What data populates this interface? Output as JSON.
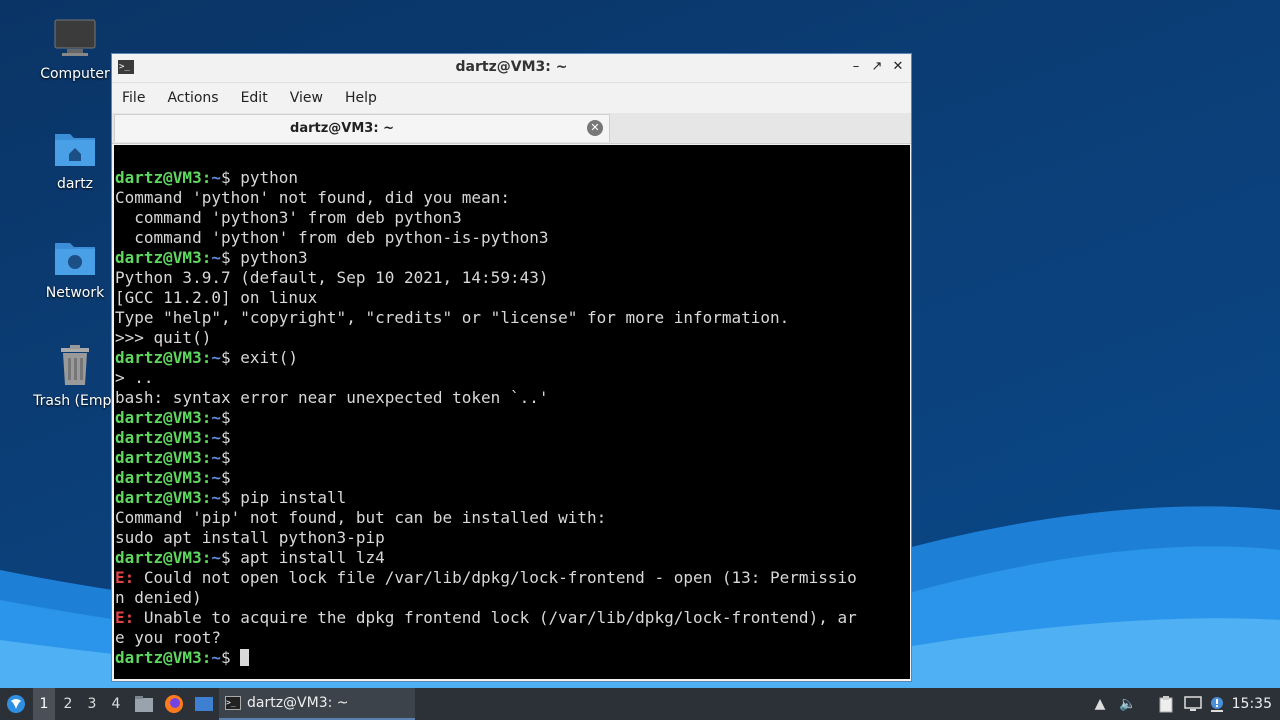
{
  "desktop": {
    "icons": [
      {
        "label": "Computer",
        "icon": "computer-icon"
      },
      {
        "label": "dartz",
        "icon": "home-folder-icon"
      },
      {
        "label": "Network",
        "icon": "network-folder-icon"
      },
      {
        "label": "Trash (Empt",
        "icon": "trash-icon"
      }
    ]
  },
  "window": {
    "title": "dartz@VM3: ~",
    "menu": [
      "File",
      "Actions",
      "Edit",
      "View",
      "Help"
    ],
    "tab_label": "dartz@VM3: ~"
  },
  "terminal": {
    "prompt_user": "dartz@VM3",
    "prompt_sep": ":",
    "prompt_path": "~",
    "prompt_dollar": "$ ",
    "error_tag": "E:",
    "lines": [
      {
        "type": "prompt",
        "cmd": "python"
      },
      {
        "type": "out",
        "text": "Command 'python' not found, did you mean:"
      },
      {
        "type": "out",
        "text": "  command 'python3' from deb python3"
      },
      {
        "type": "out",
        "text": "  command 'python' from deb python-is-python3"
      },
      {
        "type": "prompt",
        "cmd": "python3"
      },
      {
        "type": "out",
        "text": "Python 3.9.7 (default, Sep 10 2021, 14:59:43)"
      },
      {
        "type": "out",
        "text": "[GCC 11.2.0] on linux"
      },
      {
        "type": "out",
        "text": "Type \"help\", \"copyright\", \"credits\" or \"license\" for more information."
      },
      {
        "type": "out",
        "text": ">>> quit()"
      },
      {
        "type": "prompt",
        "cmd": "exit()"
      },
      {
        "type": "out",
        "text": "> .."
      },
      {
        "type": "out",
        "text": "bash: syntax error near unexpected token `..'"
      },
      {
        "type": "prompt",
        "cmd": ""
      },
      {
        "type": "prompt",
        "cmd": ""
      },
      {
        "type": "prompt",
        "cmd": ""
      },
      {
        "type": "prompt",
        "cmd": ""
      },
      {
        "type": "prompt",
        "cmd": "pip install"
      },
      {
        "type": "out",
        "text": "Command 'pip' not found, but can be installed with:"
      },
      {
        "type": "out",
        "text": "sudo apt install python3-pip"
      },
      {
        "type": "prompt",
        "cmd": "apt install lz4"
      },
      {
        "type": "err",
        "text": " Could not open lock file /var/lib/dpkg/lock-frontend - open (13: Permissio"
      },
      {
        "type": "out",
        "text": "n denied)"
      },
      {
        "type": "err",
        "text": " Unable to acquire the dpkg frontend lock (/var/lib/dpkg/lock-frontend), ar"
      },
      {
        "type": "out",
        "text": "e you root?"
      },
      {
        "type": "prompt",
        "cmd": "",
        "cursor": true
      }
    ]
  },
  "taskbar": {
    "workspaces": [
      "1",
      "2",
      "3",
      "4"
    ],
    "active_workspace": "1",
    "task_label": "dartz@VM3: ~",
    "clock": "15:35",
    "tray_icons": [
      "updates-icon",
      "volume-icon",
      "clipboard-icon",
      "network-tray-icon",
      "notification-icon"
    ]
  }
}
